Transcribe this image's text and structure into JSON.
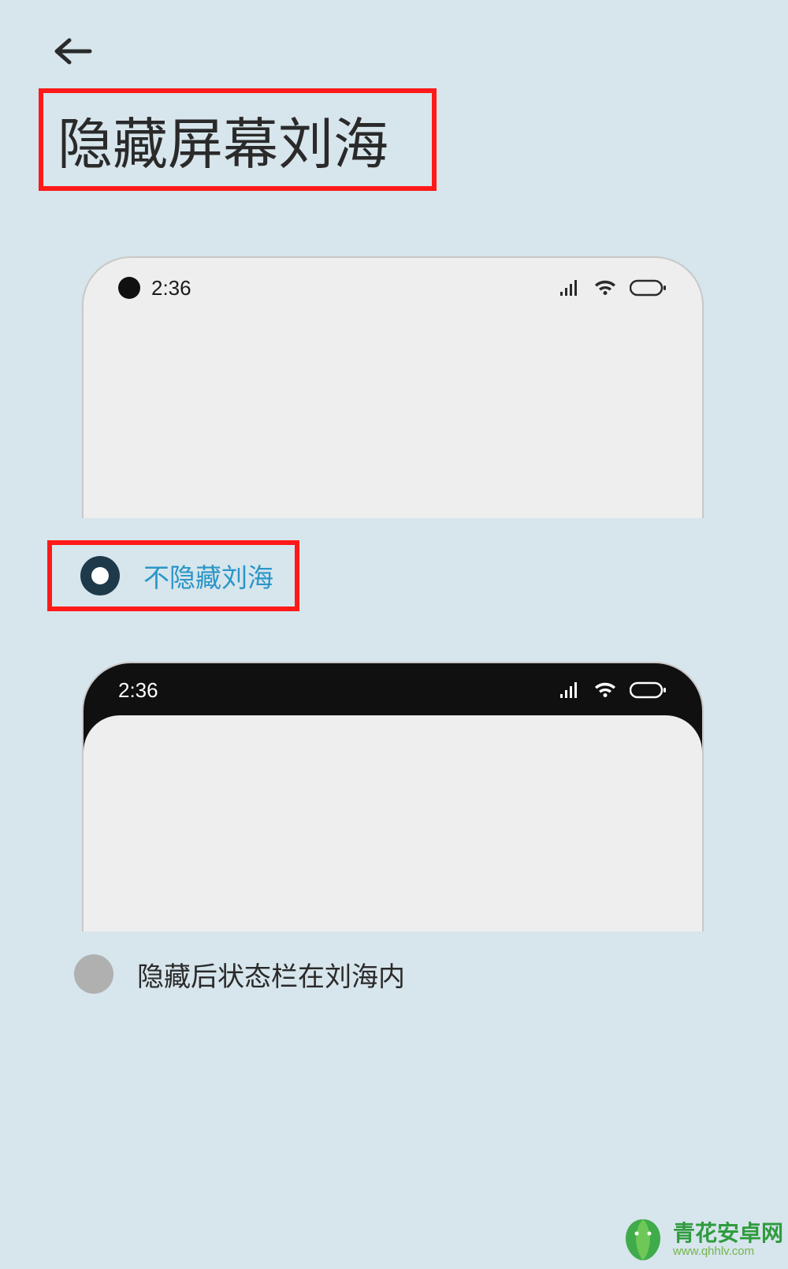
{
  "header": {
    "title": "隐藏屏幕刘海"
  },
  "statusbar": {
    "time": "2:36"
  },
  "options": [
    {
      "label": "不隐藏刘海",
      "selected": true
    },
    {
      "label": "隐藏后状态栏在刘海内",
      "selected": false
    }
  ],
  "watermark": {
    "brand": "青花安卓网",
    "url": "www.qhhlv.com"
  },
  "colors": {
    "highlight": "#ff1a1a",
    "accent": "#2a96c8",
    "radio_fill": "#1e3a4a"
  }
}
